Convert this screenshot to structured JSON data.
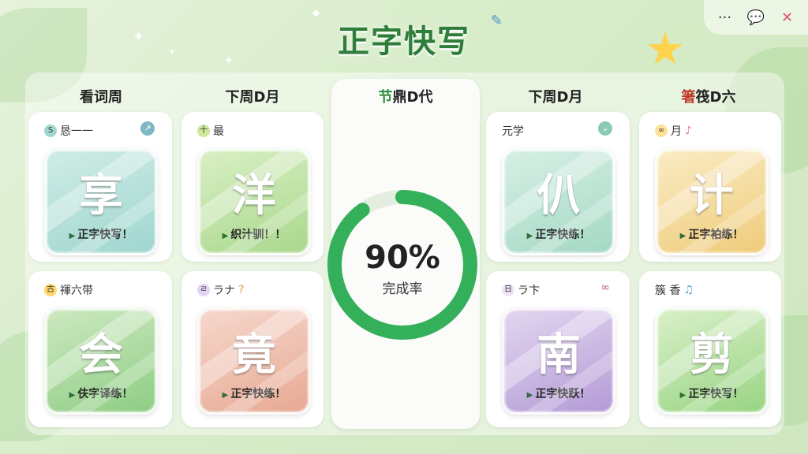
{
  "app": {
    "title": "正字快写"
  },
  "toolbar": {
    "more_icon": "ellipsis-icon",
    "more_label": "···",
    "chat_icon": "chat-bubble-icon",
    "chat_label": "💬",
    "close_icon": "close-icon",
    "close_label": "✕"
  },
  "columns": [
    {
      "header": "看词周"
    },
    {
      "header": "下周D月"
    },
    {
      "header_hl": "节",
      "header": "鼎D代"
    },
    {
      "header": "下周D月"
    },
    {
      "header_hl": "箸",
      "header": "筏D六"
    }
  ],
  "cards": [
    {
      "label": "恳一一",
      "chip": "S",
      "chip_color": "#9fd6cf",
      "corner": "↗",
      "corner_color": "#7fb8c4",
      "glyph": "享",
      "caption": "正字快写！",
      "tone": "teal"
    },
    {
      "label": "最",
      "chip": "十",
      "chip_color": "#cde89c",
      "glyph": "洋",
      "caption": "织汁驯！！",
      "tone": "green"
    },
    {
      "label": "元学",
      "chip": "",
      "chip_color": "#ffffff",
      "corner": "⌄",
      "corner_color": "#8ccab8",
      "glyph": "仈",
      "caption": "正字快练！",
      "tone": "mint"
    },
    {
      "label": "月",
      "chip": "∞",
      "chip_color": "#ffe19a",
      "glyph": "计",
      "caption": "正字袙练！",
      "tone": "yellow"
    },
    {
      "label": "禈六带",
      "chip": "古",
      "chip_color": "#ffd86b",
      "glyph": "会",
      "caption": "伕字译练！",
      "tone": "green2"
    },
    {
      "label": "ラナ",
      "chip": "ㄹ",
      "chip_color": "#e4d4f5",
      "glyph": "竟",
      "caption": "正字快练！",
      "tone": "peach"
    },
    {
      "label": "ラ卞",
      "chip": "日",
      "chip_color": "#efe4f7",
      "glyph": "南",
      "caption": "正字快跃！",
      "tone": "violet"
    },
    {
      "label": "簇 香",
      "chip": "",
      "chip_color": "#ffffff",
      "glyph": "剪",
      "caption": "正字快写！",
      "tone": "lime"
    }
  ],
  "progress": {
    "value": 90,
    "display": "90%",
    "label": "完成率",
    "color": "#35b05a"
  }
}
